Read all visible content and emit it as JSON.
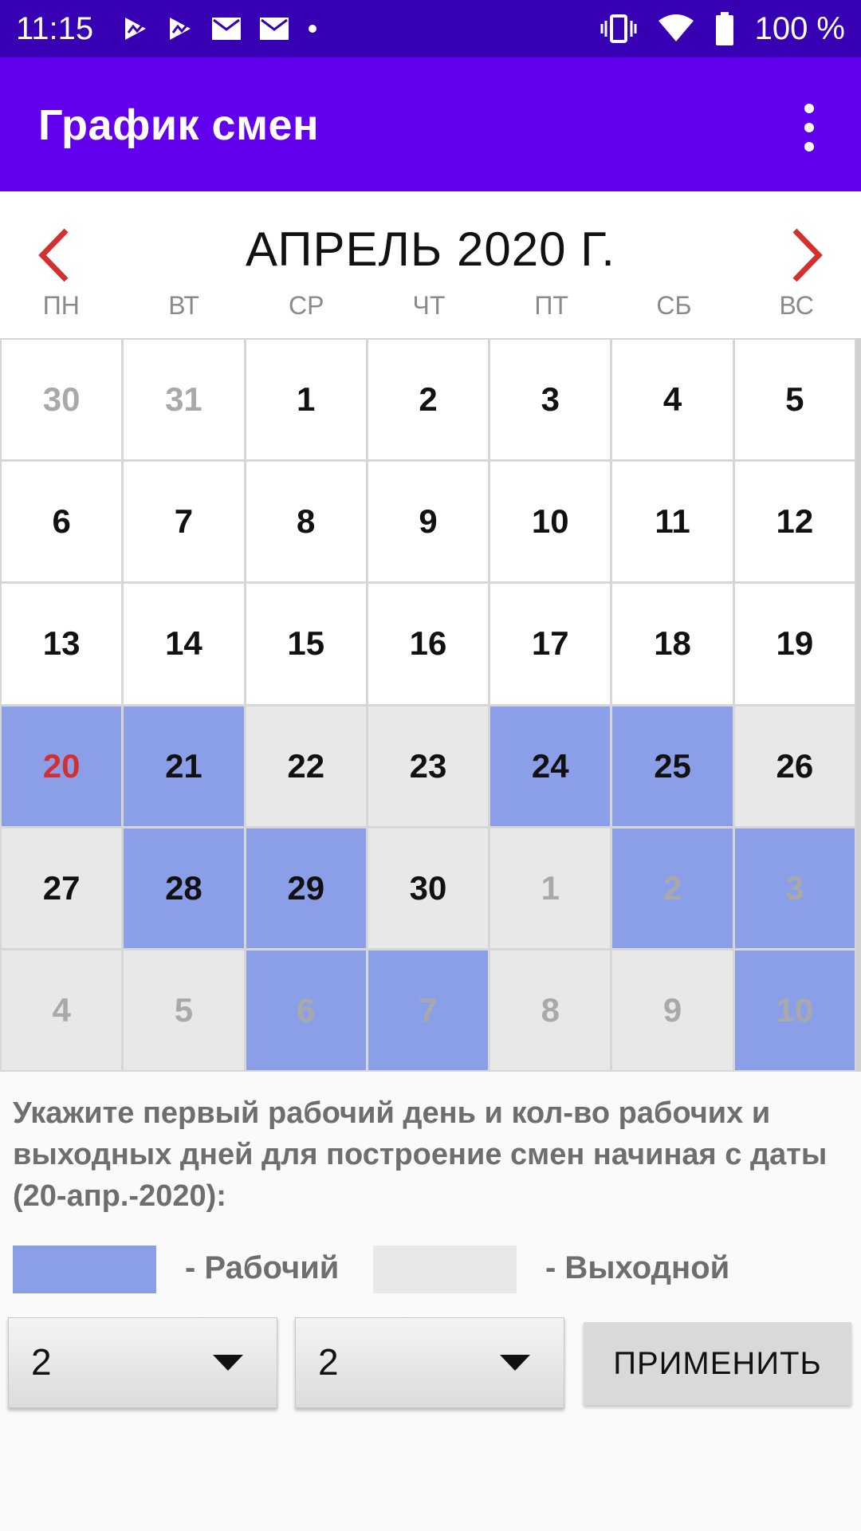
{
  "status_bar": {
    "time": "11:15",
    "battery": "100 %",
    "icons_left": [
      "play-store-icon",
      "play-store-icon",
      "mail-icon",
      "mail-icon",
      "dot-icon"
    ],
    "icons_right": [
      "vibrate-icon",
      "wifi-icon",
      "battery-icon"
    ]
  },
  "app_bar": {
    "title": "График смен",
    "menu_icon": "more-vert-icon"
  },
  "calendar": {
    "month_title": "АПРЕЛЬ 2020 Г.",
    "prev_icon": "chevron-left-icon",
    "next_icon": "chevron-right-icon",
    "weekdays": [
      "ПН",
      "ВТ",
      "СР",
      "ЧТ",
      "ПТ",
      "СБ",
      "ВС"
    ],
    "days": [
      {
        "n": "30",
        "bg": "white",
        "tc": "gray"
      },
      {
        "n": "31",
        "bg": "white",
        "tc": "gray"
      },
      {
        "n": "1",
        "bg": "white",
        "tc": "dark"
      },
      {
        "n": "2",
        "bg": "white",
        "tc": "dark"
      },
      {
        "n": "3",
        "bg": "white",
        "tc": "dark"
      },
      {
        "n": "4",
        "bg": "white",
        "tc": "dark"
      },
      {
        "n": "5",
        "bg": "white",
        "tc": "dark"
      },
      {
        "n": "6",
        "bg": "white",
        "tc": "dark"
      },
      {
        "n": "7",
        "bg": "white",
        "tc": "dark"
      },
      {
        "n": "8",
        "bg": "white",
        "tc": "dark"
      },
      {
        "n": "9",
        "bg": "white",
        "tc": "dark"
      },
      {
        "n": "10",
        "bg": "white",
        "tc": "dark"
      },
      {
        "n": "11",
        "bg": "white",
        "tc": "dark"
      },
      {
        "n": "12",
        "bg": "white",
        "tc": "dark"
      },
      {
        "n": "13",
        "bg": "white",
        "tc": "dark"
      },
      {
        "n": "14",
        "bg": "white",
        "tc": "dark"
      },
      {
        "n": "15",
        "bg": "white",
        "tc": "dark"
      },
      {
        "n": "16",
        "bg": "white",
        "tc": "dark"
      },
      {
        "n": "17",
        "bg": "white",
        "tc": "dark"
      },
      {
        "n": "18",
        "bg": "white",
        "tc": "dark"
      },
      {
        "n": "19",
        "bg": "white",
        "tc": "dark"
      },
      {
        "n": "20",
        "bg": "work",
        "tc": "red"
      },
      {
        "n": "21",
        "bg": "work",
        "tc": "dark"
      },
      {
        "n": "22",
        "bg": "off",
        "tc": "dark"
      },
      {
        "n": "23",
        "bg": "off",
        "tc": "dark"
      },
      {
        "n": "24",
        "bg": "work",
        "tc": "dark"
      },
      {
        "n": "25",
        "bg": "work",
        "tc": "dark"
      },
      {
        "n": "26",
        "bg": "off",
        "tc": "dark"
      },
      {
        "n": "27",
        "bg": "off",
        "tc": "dark"
      },
      {
        "n": "28",
        "bg": "work",
        "tc": "dark"
      },
      {
        "n": "29",
        "bg": "work",
        "tc": "dark"
      },
      {
        "n": "30",
        "bg": "off",
        "tc": "dark"
      },
      {
        "n": "1",
        "bg": "off",
        "tc": "gray"
      },
      {
        "n": "2",
        "bg": "work",
        "tc": "gray"
      },
      {
        "n": "3",
        "bg": "work",
        "tc": "gray"
      },
      {
        "n": "4",
        "bg": "off",
        "tc": "gray"
      },
      {
        "n": "5",
        "bg": "off",
        "tc": "gray"
      },
      {
        "n": "6",
        "bg": "work",
        "tc": "gray"
      },
      {
        "n": "7",
        "bg": "work",
        "tc": "gray"
      },
      {
        "n": "8",
        "bg": "off",
        "tc": "gray"
      },
      {
        "n": "9",
        "bg": "off",
        "tc": "gray"
      },
      {
        "n": "10",
        "bg": "work",
        "tc": "gray"
      }
    ]
  },
  "info": {
    "text": "Укажите первый рабочий день и кол-во рабочих и выходных дней для построение смен начиная с даты (20-апр.-2020):"
  },
  "legend": {
    "work_label": "- Рабочий",
    "off_label": "- Выходной"
  },
  "controls": {
    "work_days_value": "2",
    "off_days_value": "2",
    "apply_label": "ПРИМЕНИТЬ"
  },
  "colors": {
    "status_bar": "#3700b3",
    "app_bar": "#6200ee",
    "work_day": "#8a9fe8",
    "off_day": "#e8e8e8",
    "today_text": "#d32f2f",
    "nav_arrow": "#d32f2f"
  }
}
